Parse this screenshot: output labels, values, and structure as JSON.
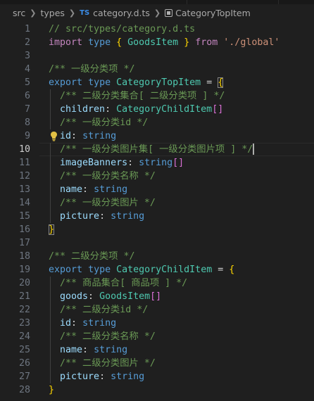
{
  "breadcrumb": {
    "items": [
      "src",
      "types",
      "category.d.ts",
      "CategoryTopItem"
    ],
    "file_badge": "TS"
  },
  "editor": {
    "active_line": 10,
    "lines": [
      {
        "n": "1",
        "text": "// src/types/category.d.ts"
      },
      {
        "n": "2",
        "text": "import type { GoodsItem } from './global'"
      },
      {
        "n": "3",
        "text": ""
      },
      {
        "n": "4",
        "text": "/** 一级分类项 */"
      },
      {
        "n": "5",
        "text": "export type CategoryTopItem = {"
      },
      {
        "n": "6",
        "text": "  /** 二级分类集合[ 二级分类项 ] */"
      },
      {
        "n": "7",
        "text": "  children: CategoryChildItem[]"
      },
      {
        "n": "8",
        "text": "  /** 一级分类id */"
      },
      {
        "n": "9",
        "text": "  id: string"
      },
      {
        "n": "10",
        "text": "  /** 一级分类图片集[ 一级分类图片项 ] */"
      },
      {
        "n": "11",
        "text": "  imageBanners: string[]"
      },
      {
        "n": "12",
        "text": "  /** 一级分类名称 */"
      },
      {
        "n": "13",
        "text": "  name: string"
      },
      {
        "n": "14",
        "text": "  /** 一级分类图片 */"
      },
      {
        "n": "15",
        "text": "  picture: string"
      },
      {
        "n": "16",
        "text": "}"
      },
      {
        "n": "17",
        "text": ""
      },
      {
        "n": "18",
        "text": "/** 二级分类项 */"
      },
      {
        "n": "19",
        "text": "export type CategoryChildItem = {"
      },
      {
        "n": "20",
        "text": "  /** 商品集合[ 商品项 ] */"
      },
      {
        "n": "21",
        "text": "  goods: GoodsItem[]"
      },
      {
        "n": "22",
        "text": "  /** 二级分类id */"
      },
      {
        "n": "23",
        "text": "  id: string"
      },
      {
        "n": "24",
        "text": "  /** 二级分类名称 */"
      },
      {
        "n": "25",
        "text": "  name: string"
      },
      {
        "n": "26",
        "text": "  /** 二级分类图片 */"
      },
      {
        "n": "27",
        "text": "  picture: string"
      },
      {
        "n": "28",
        "text": "}"
      }
    ]
  },
  "colors": {
    "background": "#1f1f1f",
    "comment": "#6a9955",
    "keyword": "#569cd6",
    "import_keyword": "#c586c0",
    "type": "#4ec9b0",
    "property": "#9cdcfe",
    "string": "#ce9178",
    "bracket_level1": "#ffd700",
    "bracket_level2": "#da70d6"
  },
  "icons": [
    "chevron-right-icon",
    "typescript-file-icon",
    "symbol-type-icon",
    "lightbulb-icon"
  ]
}
